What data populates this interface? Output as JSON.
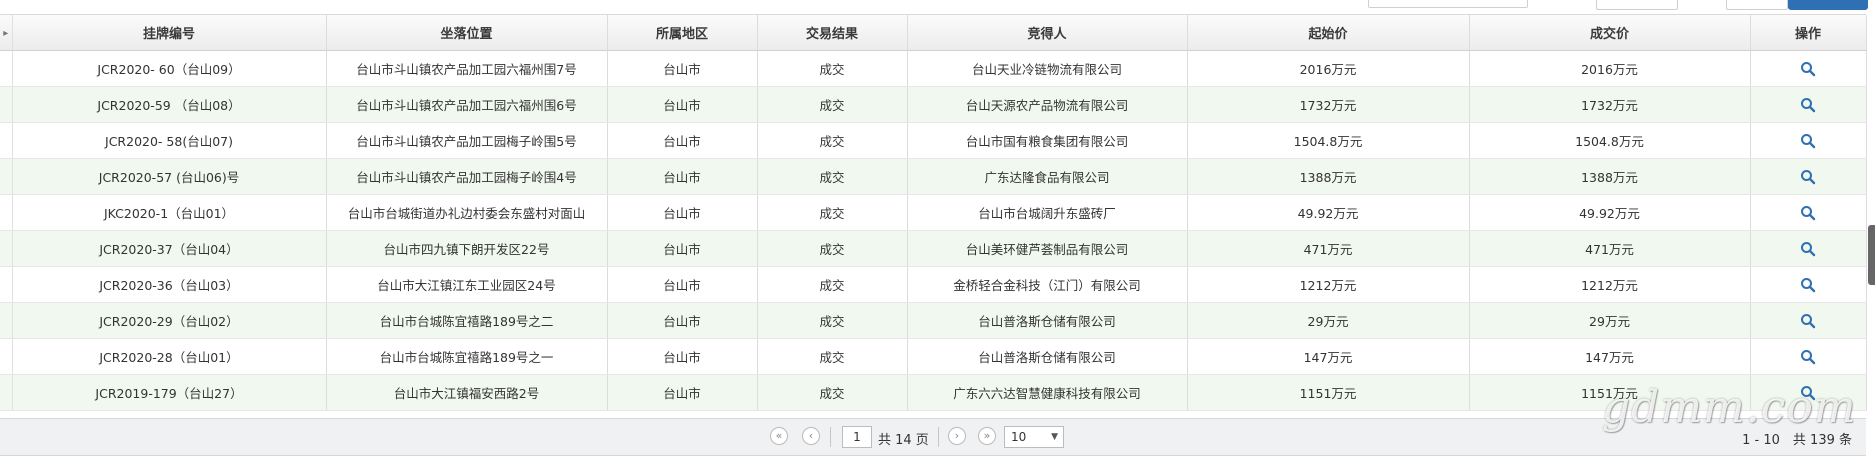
{
  "columns": [
    "",
    "挂牌编号",
    "坐落位置",
    "所属地区",
    "交易结果",
    "竞得人",
    "起始价",
    "成交价",
    "操作"
  ],
  "rows": [
    {
      "code": "JCR2020- 60（台山09）",
      "location": "台山市斗山镇农产品加工园六福州围7号",
      "region": "台山市",
      "result": "成交",
      "winner": "台山天业冷链物流有限公司",
      "start_price": "2016万元",
      "deal_price": "2016万元"
    },
    {
      "code": "JCR2020-59 （台山08）",
      "location": "台山市斗山镇农产品加工园六福州围6号",
      "region": "台山市",
      "result": "成交",
      "winner": "台山天源农产品物流有限公司",
      "start_price": "1732万元",
      "deal_price": "1732万元"
    },
    {
      "code": "JCR2020- 58(台山07)",
      "location": "台山市斗山镇农产品加工园梅子岭围5号",
      "region": "台山市",
      "result": "成交",
      "winner": "台山市国有粮食集团有限公司",
      "start_price": "1504.8万元",
      "deal_price": "1504.8万元"
    },
    {
      "code": "JCR2020-57 (台山06)号",
      "location": "台山市斗山镇农产品加工园梅子岭围4号",
      "region": "台山市",
      "result": "成交",
      "winner": "广东达隆食品有限公司",
      "start_price": "1388万元",
      "deal_price": "1388万元"
    },
    {
      "code": "JKC2020-1（台山01）",
      "location": "台山市台城街道办礼边村委会东盛村对面山",
      "region": "台山市",
      "result": "成交",
      "winner": "台山市台城阔升东盛砖厂",
      "start_price": "49.92万元",
      "deal_price": "49.92万元"
    },
    {
      "code": "JCR2020-37（台山04）",
      "location": "台山市四九镇下朗开发区22号",
      "region": "台山市",
      "result": "成交",
      "winner": "台山美环健芦荟制品有限公司",
      "start_price": "471万元",
      "deal_price": "471万元"
    },
    {
      "code": "JCR2020-36（台山03）",
      "location": "台山市大江镇江东工业园区24号",
      "region": "台山市",
      "result": "成交",
      "winner": "金桥轻合金科技（江门）有限公司",
      "start_price": "1212万元",
      "deal_price": "1212万元"
    },
    {
      "code": "JCR2020-29（台山02）",
      "location": "台山市台城陈宜禧路189号之二",
      "region": "台山市",
      "result": "成交",
      "winner": "台山普洛斯仓储有限公司",
      "start_price": "29万元",
      "deal_price": "29万元"
    },
    {
      "code": "JCR2020-28（台山01）",
      "location": "台山市台城陈宜禧路189号之一",
      "region": "台山市",
      "result": "成交",
      "winner": "台山普洛斯仓储有限公司",
      "start_price": "147万元",
      "deal_price": "147万元"
    },
    {
      "code": "JCR2019-179（台山27）",
      "location": "台山市大江镇福安西路2号",
      "region": "台山市",
      "result": "成交",
      "winner": "广东六六达智慧健康科技有限公司",
      "start_price": "1151万元",
      "deal_price": "1151万元"
    }
  ],
  "pagination": {
    "current_page": "1",
    "total_pages_text": "共 14 页",
    "page_size": "10",
    "range_text": "1 - 10　共 139 条"
  },
  "watermark": "gdmm.com",
  "colors": {
    "accent": "#2f6fb3",
    "even_row": "#f1f8ef",
    "header_bg": "#ececec"
  },
  "icons": {
    "action": "search-icon"
  }
}
